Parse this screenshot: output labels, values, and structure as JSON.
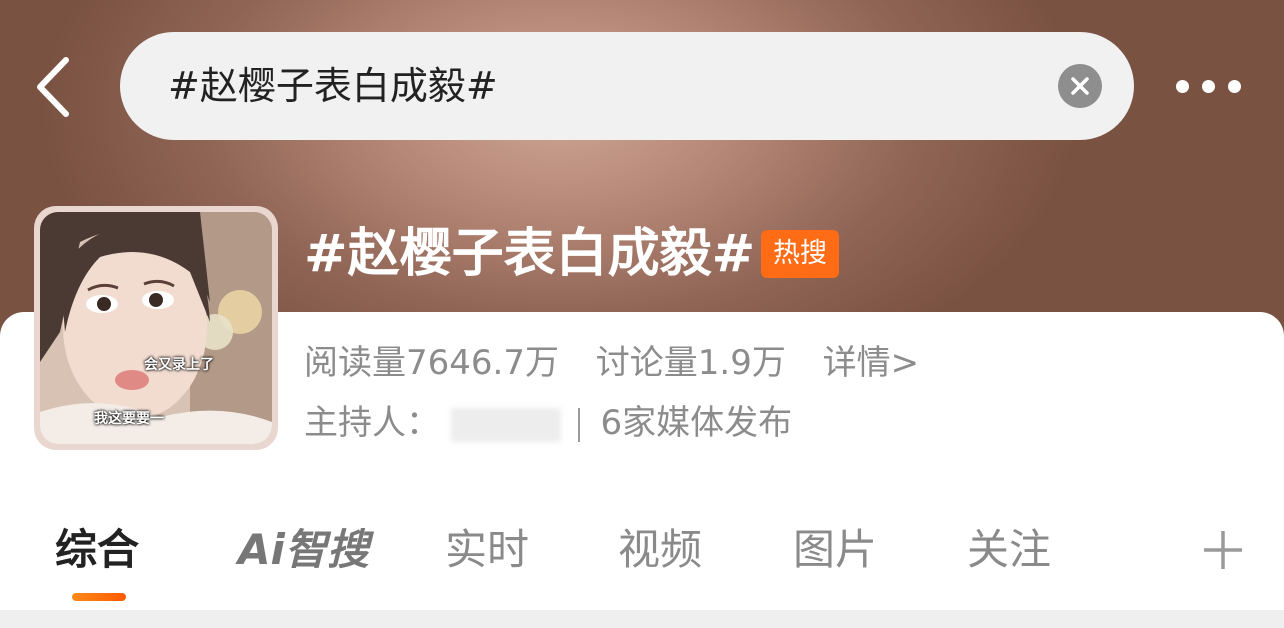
{
  "header": {
    "search_query": "#赵樱子表白成毅#"
  },
  "topic": {
    "title": "#赵樱子表白成毅#",
    "badge": "热搜",
    "reads": "阅读量7646.7万",
    "discussions": "讨论量1.9万",
    "details_link": "详情>",
    "host_label": "主持人：",
    "media": "6家媒体发布",
    "cover_captions": [
      "会又录上了",
      "我这要要一"
    ]
  },
  "tabs": [
    {
      "label": "综合"
    },
    {
      "label": "Ai智搜"
    },
    {
      "label": "实时"
    },
    {
      "label": "视频"
    },
    {
      "label": "图片"
    },
    {
      "label": "关注"
    }
  ],
  "colors": {
    "accent": "#ff6c15",
    "badge_bg": "#ff6c15",
    "indicator": "#ff7a0f"
  },
  "icons": {
    "back": "chevron-left-icon",
    "clear": "close-circle-icon",
    "more": "more-dots-icon",
    "add": "plus-icon"
  }
}
